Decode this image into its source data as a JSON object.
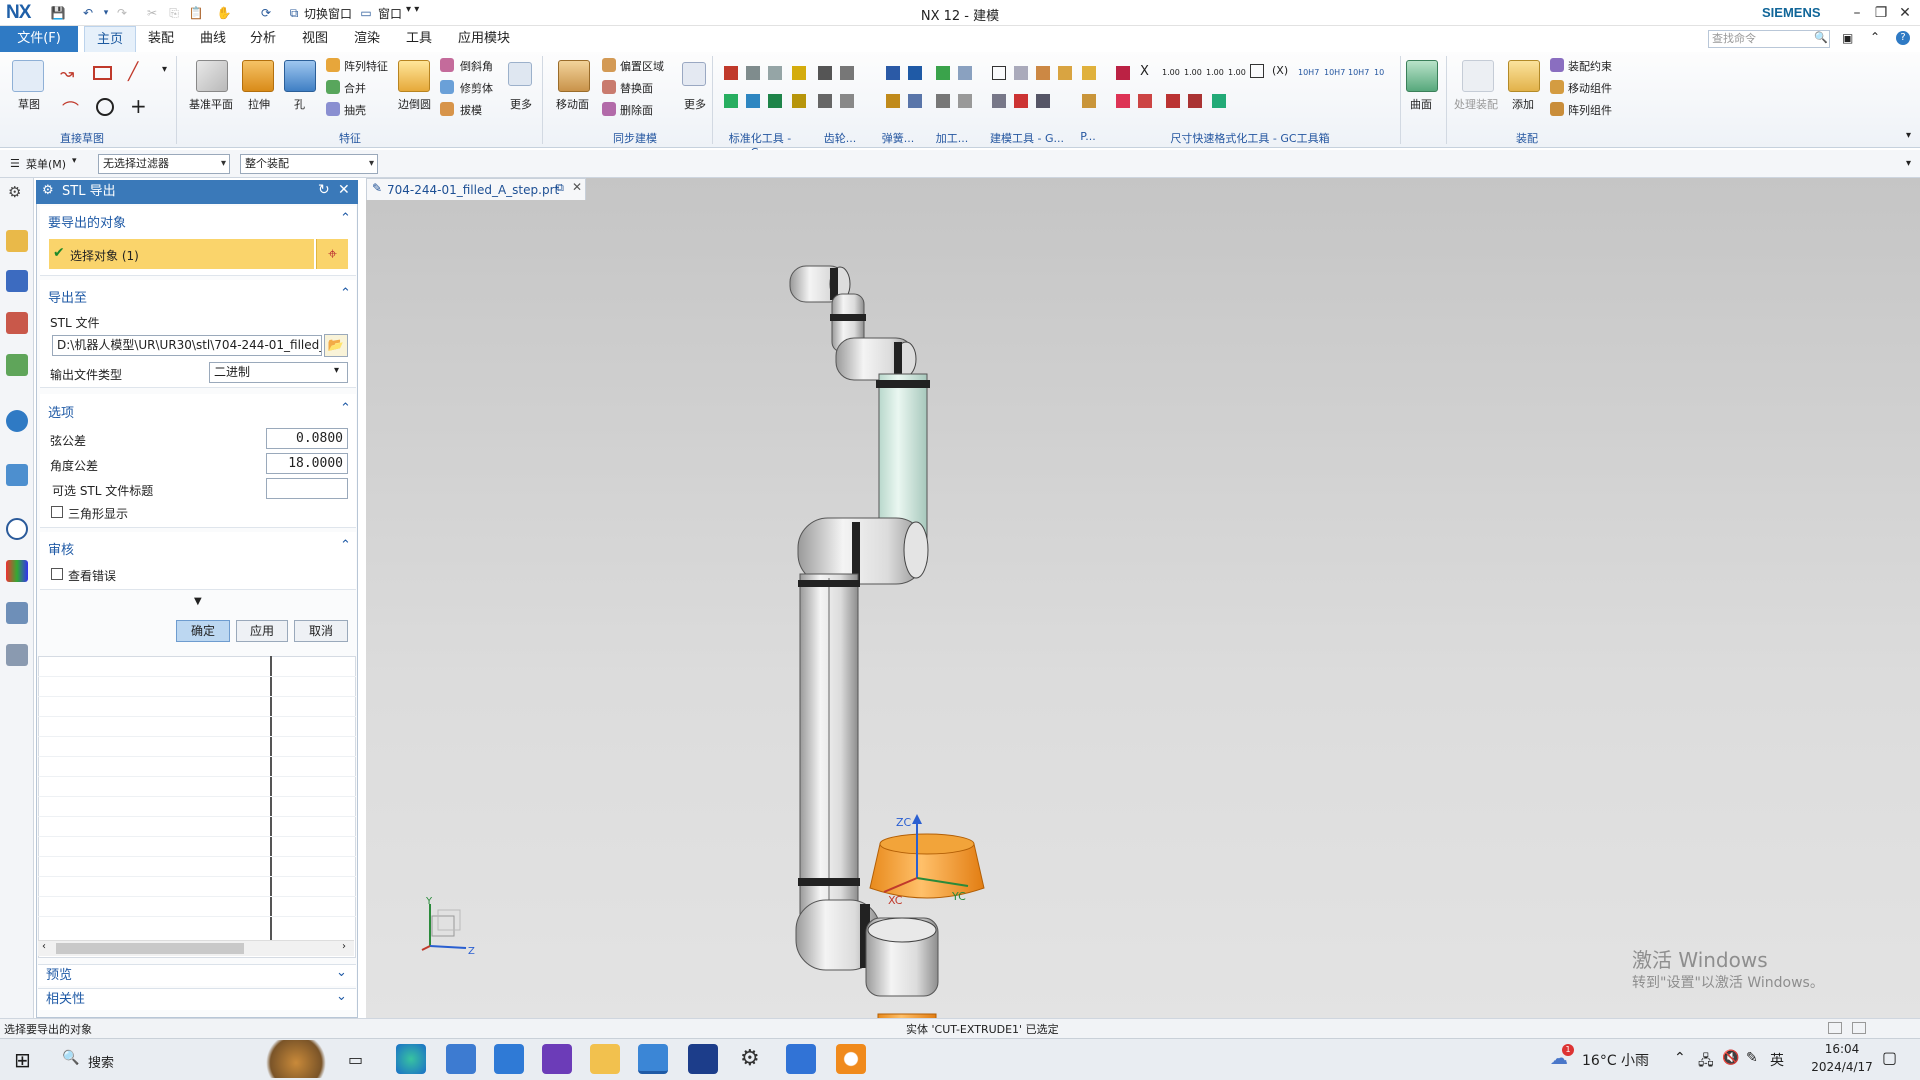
{
  "window": {
    "logo": "NX",
    "title": "NX 12 - 建模",
    "brand": "SIEMENS",
    "switch_window": "切换窗口",
    "window_menu": "窗口"
  },
  "ribbon_tabs": [
    "文件(F)",
    "主页",
    "装配",
    "曲线",
    "分析",
    "视图",
    "渲染",
    "工具",
    "应用模块"
  ],
  "search_placeholder": "查找命令",
  "ribbon": {
    "sketch": "草图",
    "group_direct_sketch": "直接草图",
    "datum_plane": "基准平面",
    "extrude": "拉伸",
    "hole": "孔",
    "pattern_feature": "阵列特征",
    "unite": "合并",
    "shell": "抽壳",
    "edge_blend": "边倒圆",
    "chamfer": "倒斜角",
    "trim_body": "修剪体",
    "draft": "拔模",
    "more": "更多",
    "group_feature": "特征",
    "move_face": "移动面",
    "offset_region": "偏置区域",
    "replace_face": "替换面",
    "delete_face": "删除面",
    "group_sync": "同步建模",
    "group_std": "标准化工具 - G...",
    "group_gear": "齿轮...",
    "group_spring": "弹簧...",
    "group_machining": "加工...",
    "group_modeling": "建模工具 - G...",
    "group_p": "P...",
    "group_dim": "尺寸快速格式化工具 - GC工具箱",
    "surface": "曲面",
    "process_assembly": "处理装配",
    "add": "添加",
    "assembly_constraint": "装配约束",
    "move_component": "移动组件",
    "pattern_component": "阵列组件",
    "group_assembly": "装配",
    "dim_labels": [
      "1.00",
      "1.00",
      "1.00",
      "1.00",
      "10H7",
      "10H7",
      "10H7",
      "10"
    ]
  },
  "toolbar2": {
    "menu": "菜单(M)",
    "filter": "无选择过滤器",
    "scope": "整个装配"
  },
  "dialog": {
    "title": "STL 导出",
    "section_objects": "要导出的对象",
    "select_object": "选择对象 (1)",
    "section_export_to": "导出至",
    "stl_file_label": "STL 文件",
    "stl_file_value": "D:\\机器人模型\\UR\\UR30\\stl\\704-244-01_filled_",
    "output_type_label": "输出文件类型",
    "output_type_value": "二进制",
    "section_options": "选项",
    "chord_tol_label": "弦公差",
    "chord_tol_value": "0.0800",
    "angle_tol_label": "角度公差",
    "angle_tol_value": "18.0000",
    "stl_header_label": "可选 STL 文件标题",
    "stl_header_value": "",
    "triangle_display": "三角形显示",
    "section_check": "审核",
    "check_errors": "查看错误",
    "ok": "确定",
    "apply": "应用",
    "cancel": "取消",
    "preview": "预览",
    "relevance": "相关性"
  },
  "viewport": {
    "doc_tab": "704-244-01_filled_A_step.prt",
    "axis_zc": "ZC",
    "axis_xc": "XC",
    "axis_yc": "YC",
    "triad_y": "Y",
    "triad_z": "Z",
    "watermark_line1": "激活 Windows",
    "watermark_line2": "转到\"设置\"以激活 Windows。"
  },
  "status": {
    "left": "选择要导出的对象",
    "center": "实体 'CUT-EXTRUDE1' 已选定"
  },
  "taskbar": {
    "search": "搜索",
    "weather": "16°C 小雨",
    "ime": "英",
    "time": "16:04",
    "date": "2024/4/17",
    "weather_badge": "1"
  },
  "colors": {
    "accent": "#2f7ac4",
    "dialog_header": "#3a79b9",
    "selection_highlight": "#fad46b",
    "base_selected": "#f5a23a"
  }
}
